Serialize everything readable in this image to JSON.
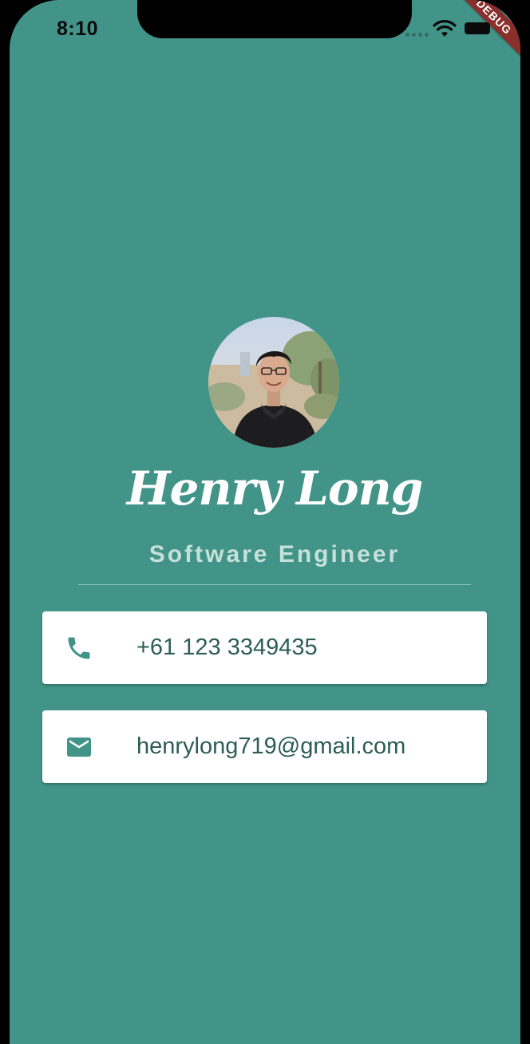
{
  "status_bar": {
    "time": "8:10",
    "icons": [
      "signal-dots-icon",
      "wifi-icon",
      "battery-icon"
    ]
  },
  "debug_banner": "DEBUG",
  "profile": {
    "avatar_icon": "profile-photo",
    "name": "Henry Long",
    "title": "Software Engineer"
  },
  "contacts": {
    "phone": {
      "icon": "phone-icon",
      "text": "+61 123 3349435"
    },
    "email": {
      "icon": "email-icon",
      "text": "henrylong719@gmail.com"
    }
  },
  "colors": {
    "background": "#429488",
    "card": "#ffffff",
    "card_text": "#2c5d56",
    "icon": "#429488",
    "subtitle": "#c6e0da",
    "debug": "#8a2f2b"
  }
}
